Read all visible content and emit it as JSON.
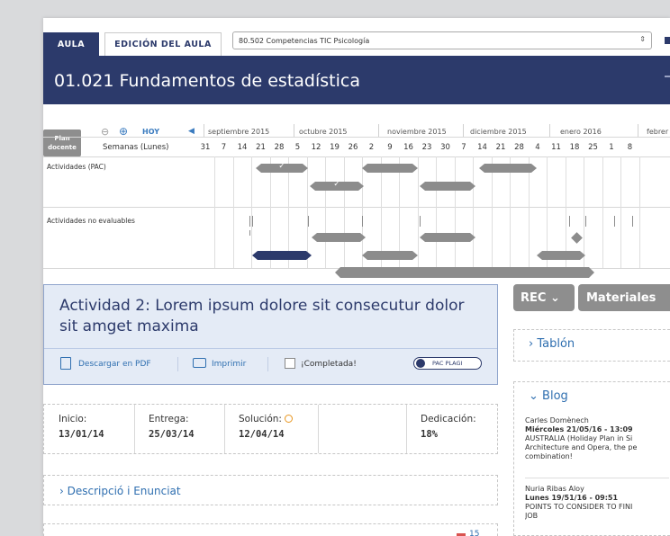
{
  "tabs": {
    "aula": "AULA",
    "edicion": "EDICIÓN DEL AULA"
  },
  "course_select": {
    "value": "80.502 Competencias TIC Psicología"
  },
  "page_title": "01.021 Fundamentos de estadística",
  "timeline": {
    "plan_button": [
      "Plan",
      "docente"
    ],
    "hoy": "HOY",
    "weeks_label": "Semanas (Lunes)",
    "months": [
      "septiembre 2015",
      "octubre 2015",
      "noviembre 2015",
      "diciembre 2015",
      "enero 2016",
      "febrer"
    ],
    "weeks": [
      "31",
      "7",
      "14",
      "21",
      "28",
      "5",
      "12",
      "19",
      "26",
      "2",
      "9",
      "16",
      "23",
      "30",
      "7",
      "14",
      "21",
      "28",
      "4",
      "11",
      "18",
      "25",
      "1",
      "8"
    ],
    "rows": [
      "Actividades (PAC)",
      "Actividades no evaluables"
    ]
  },
  "activity": {
    "title": "Actividad 2: Lorem ipsum dolore sit consecutur dolor sit amget maxima",
    "download_pdf": "Descargar en PDF",
    "print": "Imprimir",
    "completed": "¡Completada!",
    "completed_checked": false,
    "pac_plagi": "PAC PLAGI"
  },
  "dates": {
    "inicio_label": "Inicio:",
    "inicio": "13/01/14",
    "entrega_label": "Entrega:",
    "entrega": "25/03/14",
    "solucion_label": "Solución:",
    "solucion": "12/04/14",
    "dedicacion_label": "Dedicación:",
    "dedicacion": "18%"
  },
  "description_section": "Descripció i Enunciat",
  "next_count": "15",
  "sidebar": {
    "rec": "REC",
    "materiales": "Materiales",
    "tablon": "Tablón",
    "blog": "Blog",
    "posts": [
      {
        "author": "Carles Domènech",
        "date": "Miércoles 21/05/16 - 13:09",
        "text": [
          "AUSTRALIA (Holiday Plan in Si",
          "Architecture and Opera, the pe",
          "combination!"
        ]
      },
      {
        "author": "Nuria Ribas Aloy",
        "date": "Lunes 19/51/16 - 09:51",
        "text": [
          "POINTS TO CONSIDER TO FINI",
          "JOB"
        ]
      }
    ]
  },
  "colors": {
    "brand": "#2c3a6b",
    "link": "#2f6fb0",
    "bar": "#8c8c8c",
    "header_bg": "#e4ebf6"
  }
}
